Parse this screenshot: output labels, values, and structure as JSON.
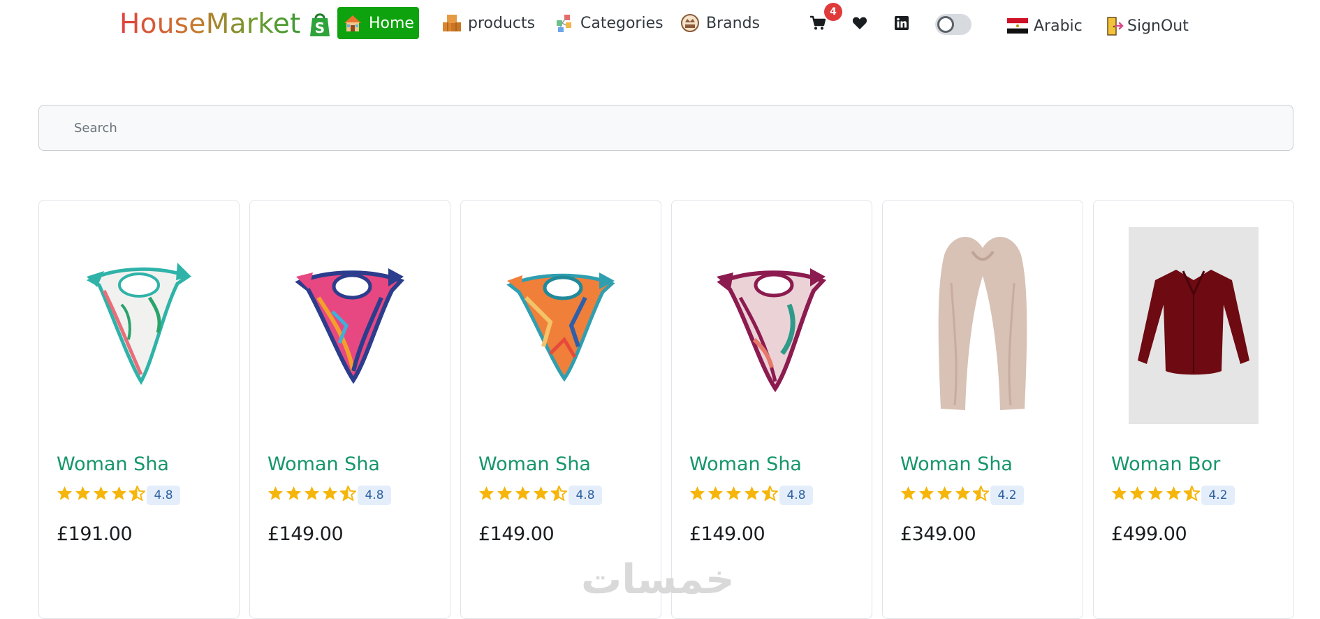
{
  "navbar": {
    "brand": "HouseMarket",
    "links": [
      {
        "label": "Home",
        "active": true
      },
      {
        "label": "products"
      },
      {
        "label": "Categories"
      },
      {
        "label": "Brands"
      }
    ],
    "cart_count": "4",
    "language": "Arabic",
    "signout": "SignOut"
  },
  "search": {
    "placeholder": "Search"
  },
  "products": [
    {
      "title": "Woman Sha",
      "rating": "4.8",
      "price": "£191.00"
    },
    {
      "title": "Woman Sha",
      "rating": "4.8",
      "price": "£149.00"
    },
    {
      "title": "Woman Sha",
      "rating": "4.8",
      "price": "£149.00"
    },
    {
      "title": "Woman Sha",
      "rating": "4.8",
      "price": "£149.00"
    },
    {
      "title": "Woman Sha",
      "rating": "4.2",
      "price": "£349.00"
    },
    {
      "title": "Woman Bor",
      "rating": "4.2",
      "price": "£499.00"
    }
  ],
  "watermark": "خمسات",
  "colors": {
    "accent": "#0ea30e",
    "title": "#16966b",
    "star": "#f5b50a",
    "badge": "#e03a3a"
  }
}
